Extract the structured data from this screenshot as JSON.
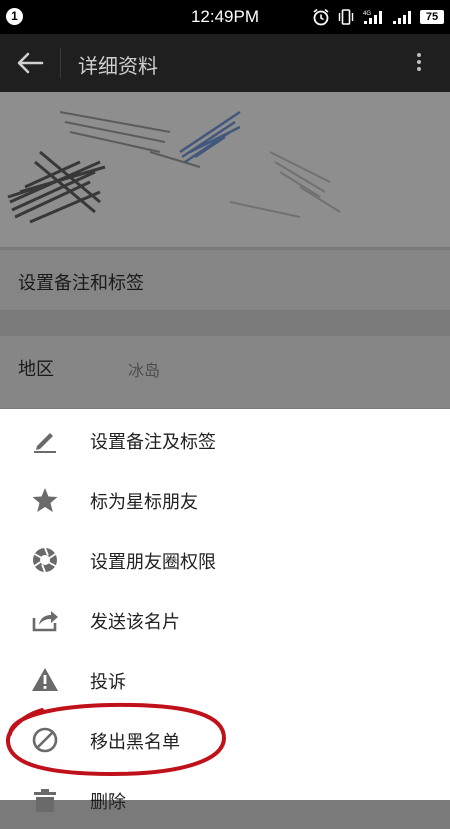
{
  "status_bar": {
    "notification_count": "1",
    "time": "12:49PM",
    "battery": "75",
    "network": "4G"
  },
  "app_bar": {
    "title": "详细资料"
  },
  "profile": {
    "remark_label": "设置备注和标签",
    "region_label": "地区",
    "region_value": "冰岛"
  },
  "menu": {
    "items": [
      {
        "label": "设置备注及标签",
        "icon": "pencil-icon"
      },
      {
        "label": "标为星标朋友",
        "icon": "star-icon"
      },
      {
        "label": "设置朋友圈权限",
        "icon": "aperture-icon"
      },
      {
        "label": "发送该名片",
        "icon": "share-icon"
      },
      {
        "label": "投诉",
        "icon": "warning-icon"
      },
      {
        "label": "移出黑名单",
        "icon": "block-icon"
      },
      {
        "label": "删除",
        "icon": "trash-icon"
      }
    ]
  },
  "colors": {
    "status_bar": "#000000",
    "app_bar": "#1f1f1f",
    "dim_overlay": "#7a7a7a",
    "sheet": "#ffffff",
    "icon": "#6a6a6a",
    "annotation": "#c0101a"
  }
}
